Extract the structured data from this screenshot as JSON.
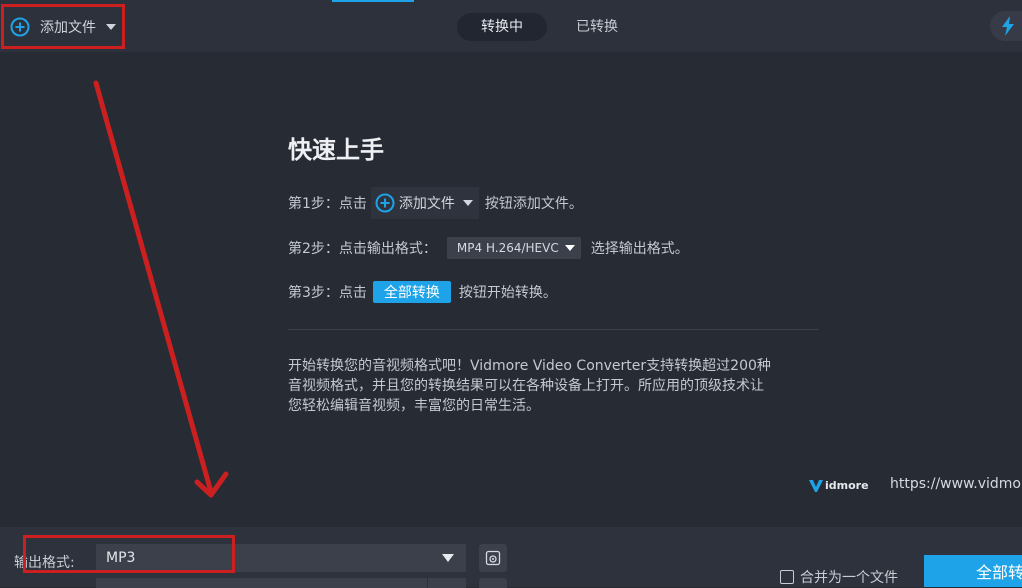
{
  "toolbar": {
    "add_file_label": "添加文件",
    "tabs": [
      {
        "label": "转换中",
        "active": true
      },
      {
        "label": "已转换",
        "active": false
      }
    ]
  },
  "quick_start": {
    "title": "快速上手",
    "step1": {
      "prefix": "第1步：点击",
      "button": "添加文件",
      "suffix": "按钮添加文件。"
    },
    "step2": {
      "prefix": "第2步：点击输出格式：",
      "format": "MP4 H.264/HEVC",
      "suffix": "选择输出格式。"
    },
    "step3": {
      "prefix": "第3步：点击",
      "button": "全部转换",
      "suffix": "按钮开始转换。"
    },
    "description": [
      "开始转换您的音视频格式吧！Vidmore Video Converter支持转换超过200种",
      "音视频格式，并且您的转换结果可以在各种设备上打开。所应用的顶级技术让",
      "您轻松编辑音视频，丰富您的日常生活。"
    ]
  },
  "brand": {
    "logo_text": "idmore",
    "url": "https://www.vidmo"
  },
  "bottom": {
    "output_label": "输出格式:",
    "output_value": "MP3",
    "merge_label": "合并为一个文件",
    "merge_checked": false,
    "convert_all_label": "全部转"
  },
  "colors": {
    "accent": "#1fa3e8",
    "annotation": "#cc2020",
    "background": "#272b34"
  },
  "icons": [
    "plus-circle-icon",
    "caret-down-icon",
    "lightning-icon",
    "vidmore-logo-icon",
    "settings-icon"
  ]
}
